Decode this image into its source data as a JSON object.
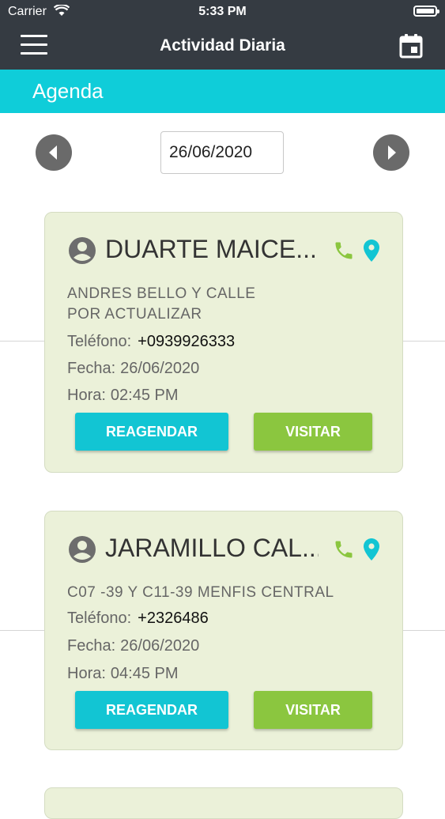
{
  "status_bar": {
    "carrier": "Carrier",
    "time": "5:33 PM"
  },
  "navbar": {
    "title": "Actividad Diaria"
  },
  "section": {
    "label": "Agenda"
  },
  "date_picker": {
    "value": "26/06/2020"
  },
  "labels": {
    "telefono": "Teléfono:",
    "fecha": "Fecha:",
    "hora": "Hora:",
    "reagendar": "REAGENDAR",
    "visitar": "VISITAR"
  },
  "colors": {
    "header": "#353b42",
    "accent": "#0fcdd9",
    "card_bg": "#ebf1d9",
    "reagendar": "#12c5d3",
    "visitar": "#8bc63f",
    "phone_icon": "#8bc63f",
    "pin_icon": "#12c5d3"
  },
  "appointments": [
    {
      "name": "DUARTE MAICE...",
      "address_line1": "ANDRES BELLO Y CALLE",
      "address_line2": "POR ACTUALIZAR",
      "phone": "+0939926333",
      "date": "26/06/2020",
      "time": "02:45 PM"
    },
    {
      "name": "JARAMILLO CAL...",
      "address_line1": "C07 -39 Y C11-39 MENFIS CENTRAL",
      "phone": "+2326486",
      "date": "26/06/2020",
      "time": "04:45 PM"
    }
  ]
}
